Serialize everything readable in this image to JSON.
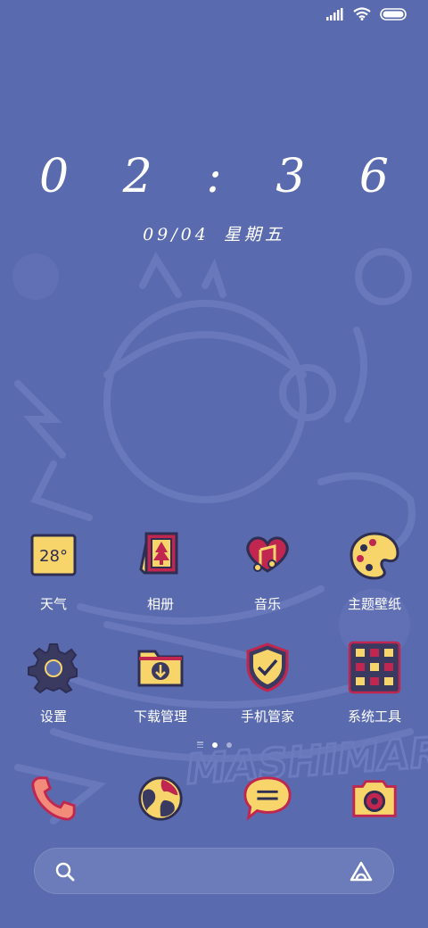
{
  "status_bar": {
    "signal_icon": "signal-bars-icon",
    "wifi_icon": "wifi-icon",
    "battery_icon": "battery-icon"
  },
  "lockscreen": {
    "time": "0 2 : 3 6",
    "date": "09/04",
    "weekday": "星期五"
  },
  "wallpaper": {
    "watermark_text": "MASHIMARO"
  },
  "apps": [
    {
      "label": "天气",
      "icon": "weather-icon",
      "badge": "28°"
    },
    {
      "label": "相册",
      "icon": "gallery-icon"
    },
    {
      "label": "音乐",
      "icon": "music-icon"
    },
    {
      "label": "主题壁纸",
      "icon": "theme-palette-icon"
    },
    {
      "label": "设置",
      "icon": "settings-gear-icon"
    },
    {
      "label": "下载管理",
      "icon": "download-folder-icon"
    },
    {
      "label": "手机管家",
      "icon": "security-shield-icon"
    },
    {
      "label": "系统工具",
      "icon": "system-tools-icon"
    }
  ],
  "pager": {
    "pages": 3,
    "active_index": 1
  },
  "dock": [
    {
      "icon": "phone-icon"
    },
    {
      "icon": "browser-globe-icon"
    },
    {
      "icon": "messages-icon"
    },
    {
      "icon": "camera-icon"
    }
  ],
  "search": {
    "placeholder": "",
    "search_icon": "search-icon",
    "assistant_icon": "assistant-icon"
  },
  "colors": {
    "background": "#5a6aae",
    "icon_yellow": "#f7d56b",
    "icon_outline": "#2e2d52",
    "icon_red": "#c0264f"
  }
}
